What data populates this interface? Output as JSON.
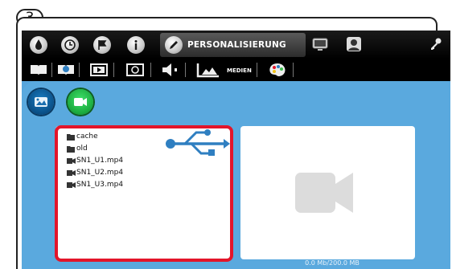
{
  "step": {
    "number": "3"
  },
  "toolbar": {
    "active_tab_label": "PERSONALISIERUNG",
    "icons": [
      "water-drop-icon",
      "clock-icon",
      "flag-icon",
      "info-icon",
      "pencil-icon",
      "monitor-icon",
      "user-icon",
      "key-icon"
    ]
  },
  "subtoolbar": {
    "medien_label": "MEDIEN",
    "icons": [
      "book-icon",
      "help-book-icon",
      "slideshow-icon",
      "camera-icon",
      "speaker-icon",
      "media-icon",
      "palette-icon"
    ]
  },
  "media_modes": {
    "image": "image-mode-icon",
    "video": "video-mode-icon"
  },
  "files": [
    {
      "name": "cache",
      "type": "folder"
    },
    {
      "name": "old",
      "type": "folder"
    },
    {
      "name": "SN1_U1.mp4",
      "type": "video"
    },
    {
      "name": "SN1_U2.mp4",
      "type": "video"
    },
    {
      "name": "SN1_U3.mp4",
      "type": "video"
    }
  ],
  "storage": {
    "text": "0.0 Mb/200.0 MB"
  },
  "colors": {
    "background": "#5aa9de",
    "highlight": "#e3152a",
    "usb": "#2f7fc1"
  }
}
